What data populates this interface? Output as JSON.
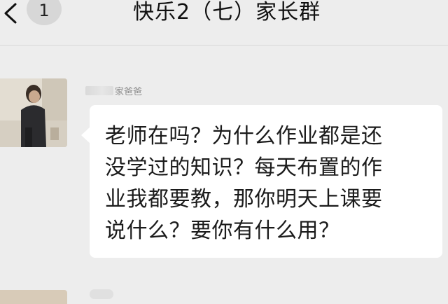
{
  "header": {
    "back_icon": "chevron-left-icon",
    "unread_count": "1",
    "title": "快乐2（七）家长群"
  },
  "messages": [
    {
      "sender_visible_suffix": "家爸爸",
      "avatar_icon": "user-photo",
      "lines": [
        "老师在吗？为什么作业都是还",
        "没学过的知识？每天布置的作",
        "业我都要教，那你明天上课要",
        "说什么？要你有什么用？"
      ]
    }
  ],
  "colors": {
    "background": "#ededed",
    "bubble": "#ffffff",
    "badge": "#d7d7d7"
  }
}
